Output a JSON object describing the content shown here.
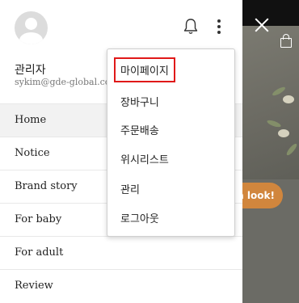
{
  "user": {
    "name": "관리자",
    "email": "sykim@gde-global.com"
  },
  "menu": [
    {
      "label": "Home"
    },
    {
      "label": "Notice"
    },
    {
      "label": "Brand story"
    },
    {
      "label": "For baby"
    },
    {
      "label": "For adult"
    },
    {
      "label": "Review"
    }
  ],
  "dropdown": [
    {
      "label": "마이페이지"
    },
    {
      "label": "장바구니"
    },
    {
      "label": "주문배송"
    },
    {
      "label": "위시리스트"
    },
    {
      "label": "관리"
    },
    {
      "label": "로그아웃"
    }
  ],
  "backdrop": {
    "cta_label": "a look!"
  },
  "icons": [
    "avatar-icon",
    "bell-icon",
    "more-vertical-icon",
    "close-icon",
    "shopping-bag-icon"
  ],
  "colors": {
    "highlight": "#e01919",
    "cta": "#d1863d"
  }
}
